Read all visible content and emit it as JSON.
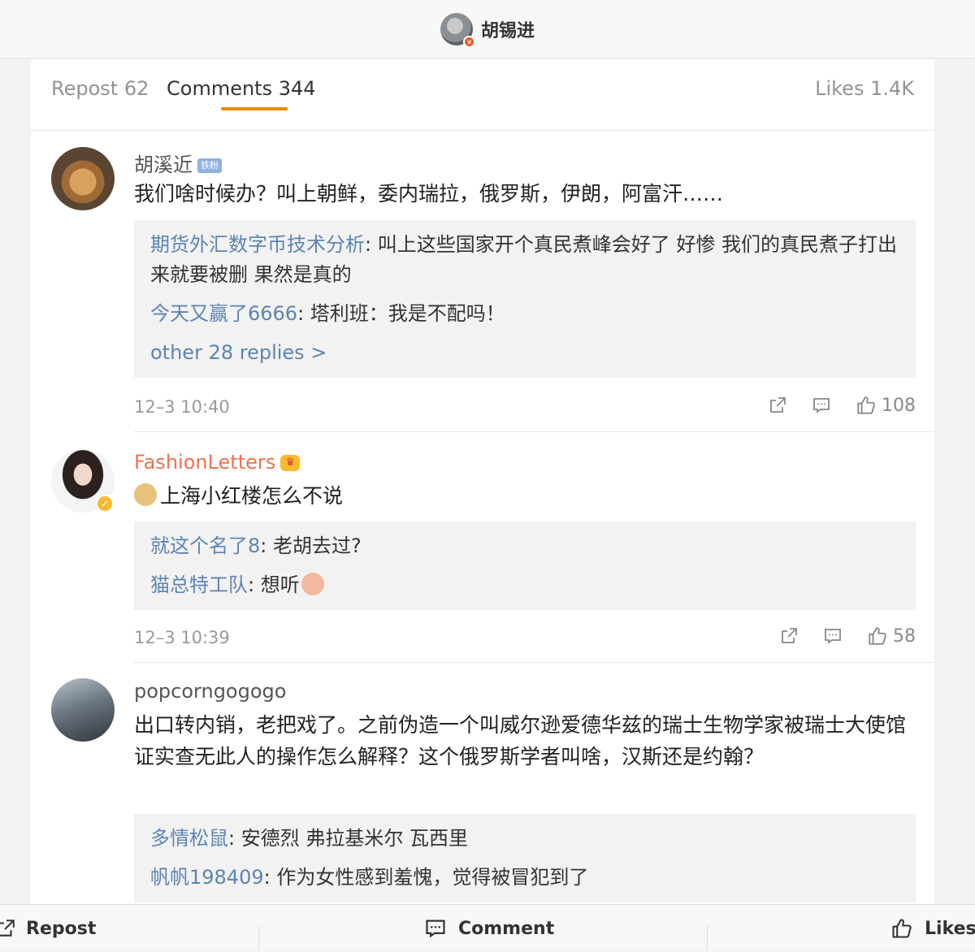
{
  "header": {
    "author": "胡锡进",
    "avatar_icon": "author-avatar",
    "verified_badge": "v"
  },
  "tabs": {
    "repost": "Repost 62",
    "comments": "Comments 344",
    "likes": "Likes 1.4K"
  },
  "comments": [
    {
      "user": "胡溪近",
      "badge": "铁粉",
      "text": "我们啥时候办？叫上朝鲜，委内瑞拉，俄罗斯，伊朗，阿富汗……",
      "replies": [
        {
          "user": "期货外汇数字币技术分析",
          "text": ": 叫上这些国家开个真民煮峰会好了 好惨 我们的真民煮子打出来就要被删 果然是真的"
        },
        {
          "user": "今天又赢了6666",
          "text": ": 塔利班：我是不配吗！"
        }
      ],
      "more": "other 28 replies >",
      "time": "12–3 10:40",
      "likes": "108"
    },
    {
      "user": "FashionLetters",
      "text": "上海小红楼怎么不说",
      "replies": [
        {
          "user": "就这个名了8",
          "text": ": 老胡去过?"
        },
        {
          "user": "猫总特工队",
          "text": ": 想听"
        }
      ],
      "time": "12–3 10:39",
      "likes": "58"
    },
    {
      "user": "popcorngogogo",
      "text": "出口转内销，老把戏了。之前伪造一个叫威尔逊爱德华兹的瑞士生物学家被瑞士大使馆证实查无此人的操作怎么解释？这个俄罗斯学者叫啥，汉斯还是约翰？",
      "replies": [
        {
          "user": "多情松鼠",
          "text": ": 安德烈 弗拉基米尔 瓦西里"
        },
        {
          "user": "帆帆198409",
          "text": ": 作为女性感到羞愧，觉得被冒犯到了"
        }
      ]
    }
  ],
  "bottom_bar": {
    "repost": "Repost",
    "comment": "Comment",
    "likes": "Likes"
  },
  "colors": {
    "accent": "#ff8200",
    "link": "#5d84b3",
    "gold_name": "#eb7350"
  }
}
